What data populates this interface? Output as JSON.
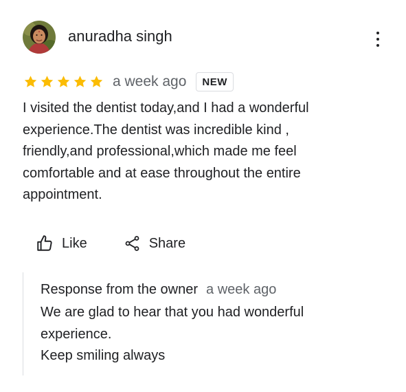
{
  "review": {
    "author": "anuradha singh",
    "avatar_icon": "user-photo-avatar",
    "more_icon": "more-vert-icon",
    "rating": 5,
    "rating_max": 5,
    "star_color": "#fbbc04",
    "time": "a week ago",
    "badge": "NEW",
    "text": "I visited the dentist today,and I had a wonderful experience.The dentist was incredible kind , friendly,and professional,which made me feel comfortable and at ease throughout the entire appointment."
  },
  "actions": {
    "like_label": "Like",
    "like_icon": "thumb-up-icon",
    "share_label": "Share",
    "share_icon": "share-icon"
  },
  "owner_response": {
    "title": "Response from the owner",
    "time": "a week ago",
    "lines": [
      "We are glad to hear that you had wonderful",
      "experience.",
      "Keep smiling always"
    ]
  }
}
